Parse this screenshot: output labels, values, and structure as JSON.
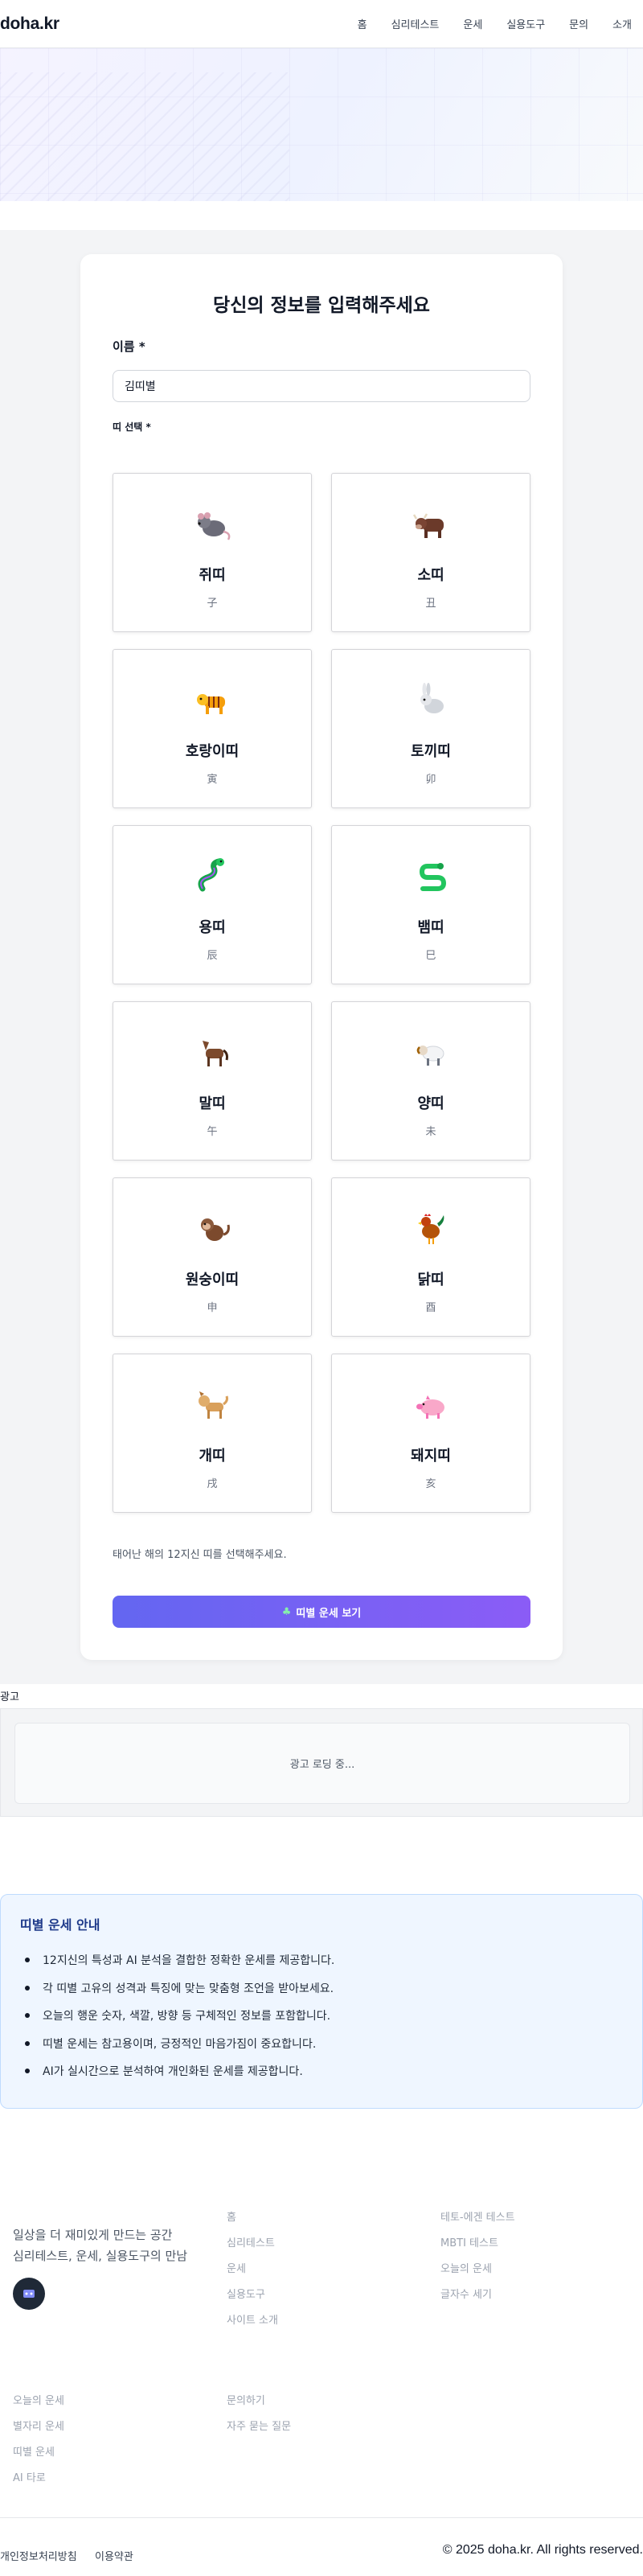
{
  "header": {
    "logo": "doha.kr",
    "nav": [
      "홈",
      "심리테스트",
      "운세",
      "실용도구",
      "문의",
      "소개"
    ]
  },
  "form": {
    "title": "당신의 정보를 입력해주세요",
    "name_label": "이름 *",
    "name_value": "김띠별",
    "zodiac_label": "띠 선택 *",
    "zodiacs": [
      {
        "name": "쥐띠",
        "hanja": "子",
        "icon": "rat-icon"
      },
      {
        "name": "소띠",
        "hanja": "丑",
        "icon": "ox-icon"
      },
      {
        "name": "호랑이띠",
        "hanja": "寅",
        "icon": "tiger-icon"
      },
      {
        "name": "토끼띠",
        "hanja": "卯",
        "icon": "rabbit-icon"
      },
      {
        "name": "용띠",
        "hanja": "辰",
        "icon": "dragon-icon"
      },
      {
        "name": "뱀띠",
        "hanja": "巳",
        "icon": "snake-icon"
      },
      {
        "name": "말띠",
        "hanja": "午",
        "icon": "horse-icon"
      },
      {
        "name": "양띠",
        "hanja": "未",
        "icon": "sheep-icon"
      },
      {
        "name": "원숭이띠",
        "hanja": "申",
        "icon": "monkey-icon"
      },
      {
        "name": "닭띠",
        "hanja": "酉",
        "icon": "rooster-icon"
      },
      {
        "name": "개띠",
        "hanja": "戌",
        "icon": "dog-icon"
      },
      {
        "name": "돼지띠",
        "hanja": "亥",
        "icon": "pig-icon"
      }
    ],
    "hint": "태어난 해의 12지신 띠를 선택해주세요.",
    "submit": "띠별 운세 보기"
  },
  "ad": {
    "label": "광고",
    "loading": "광고 로딩 중..."
  },
  "info": {
    "title": "띠별 운세 안내",
    "items": [
      "12지신의 특성과 AI 분석을 결합한 정확한 운세를 제공합니다.",
      "각 띠별 고유의 성격과 특징에 맞는 맞춤형 조언을 받아보세요.",
      "오늘의 행운 숫자, 색깔, 방향 등 구체적인 정보를 포함합니다.",
      "띠별 운세는 참고용이며, 긍정적인 마음가짐이 중요합니다.",
      "AI가 실시간으로 분석하여 개인화된 운세를 제공합니다."
    ]
  },
  "footer": {
    "tagline1": "일상을 더 재미있게 만드는 공간",
    "tagline2": "심리테스트, 운세, 실용도구의 만남",
    "col1": [
      "홈",
      "심리테스트",
      "운세",
      "실용도구",
      "사이트 소개"
    ],
    "col2": [
      "테토-에겐 테스트",
      "MBTI 테스트",
      "오늘의 운세",
      "글자수 세기"
    ],
    "col3": [
      "오늘의 운세",
      "별자리 운세",
      "띠별 운세",
      "AI 타로"
    ],
    "col4": [
      "문의하기",
      "자주 묻는 질문"
    ],
    "privacy": "개인정보처리방침",
    "terms": "이용약관",
    "copyright": "© 2025 doha.kr. All rights reserved."
  }
}
